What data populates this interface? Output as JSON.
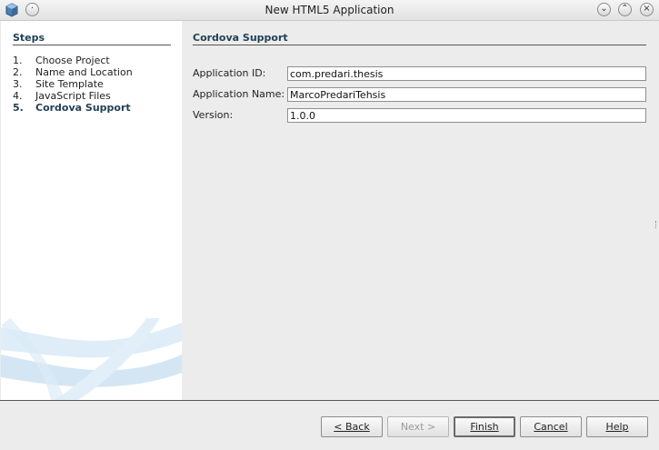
{
  "window": {
    "title": "New HTML5 Application"
  },
  "steps": {
    "heading": "Steps",
    "items": [
      {
        "num": "1.",
        "label": "Choose Project"
      },
      {
        "num": "2.",
        "label": "Name and Location"
      },
      {
        "num": "3.",
        "label": "Site Template"
      },
      {
        "num": "4.",
        "label": "JavaScript Files"
      },
      {
        "num": "5.",
        "label": "Cordova Support"
      }
    ],
    "current_index": 4
  },
  "panel": {
    "heading": "Cordova Support",
    "fields": {
      "app_id": {
        "label": "Application ID:",
        "value": "com.predari.thesis"
      },
      "app_name": {
        "label": "Application Name:",
        "value": "MarcoPredariTehsis"
      },
      "version": {
        "label": "Version:",
        "value": "1.0.0"
      }
    }
  },
  "buttons": {
    "back": "< Back",
    "next": "Next >",
    "finish": "Finish",
    "cancel": "Cancel",
    "help": "Help"
  }
}
